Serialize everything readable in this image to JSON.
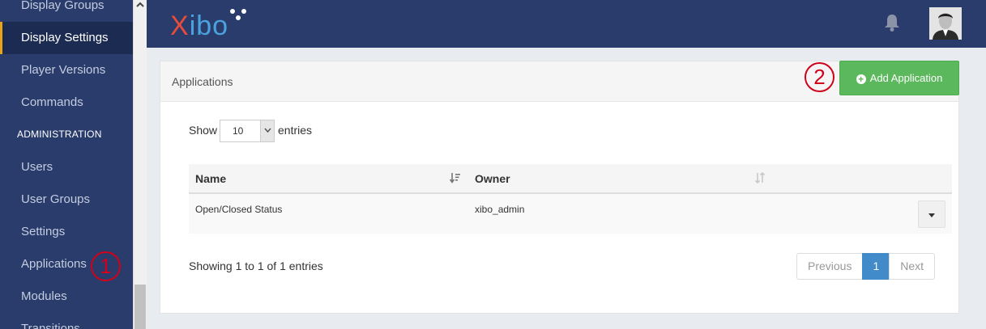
{
  "sidebar": {
    "items": [
      {
        "label": "Display Groups"
      },
      {
        "label": "Display Settings"
      },
      {
        "label": "Player Versions"
      },
      {
        "label": "Commands"
      },
      {
        "label": "Users"
      },
      {
        "label": "User Groups"
      },
      {
        "label": "Settings"
      },
      {
        "label": "Applications"
      },
      {
        "label": "Modules"
      },
      {
        "label": "Transitions"
      }
    ],
    "section_header": "ADMINISTRATION",
    "active_item": "Display Settings"
  },
  "navbar": {
    "logo": {
      "first_letter": "X",
      "rest": "ibo"
    },
    "icons": [
      "bell-icon",
      "user-avatar"
    ]
  },
  "panel": {
    "title": "Applications",
    "add_button_label": "Add Application",
    "show_label": "Show",
    "entries_value": "10",
    "entries_label": "entries",
    "table": {
      "columns": [
        "Name",
        "Owner"
      ],
      "rows": [
        {
          "name": "Open/Closed Status",
          "owner": "xibo_admin"
        }
      ]
    },
    "showing_text": "Showing 1 to 1 of 1 entries",
    "pagination": {
      "previous": "Previous",
      "current": "1",
      "next": "Next"
    }
  },
  "annotations": {
    "marker_1": "1",
    "marker_2": "2"
  },
  "colors": {
    "sidebar_bg": "#2a3c6b",
    "active_accent": "#e8a317",
    "add_button": "#5cb85c",
    "page_active": "#428bca",
    "marker": "#d0021b"
  }
}
